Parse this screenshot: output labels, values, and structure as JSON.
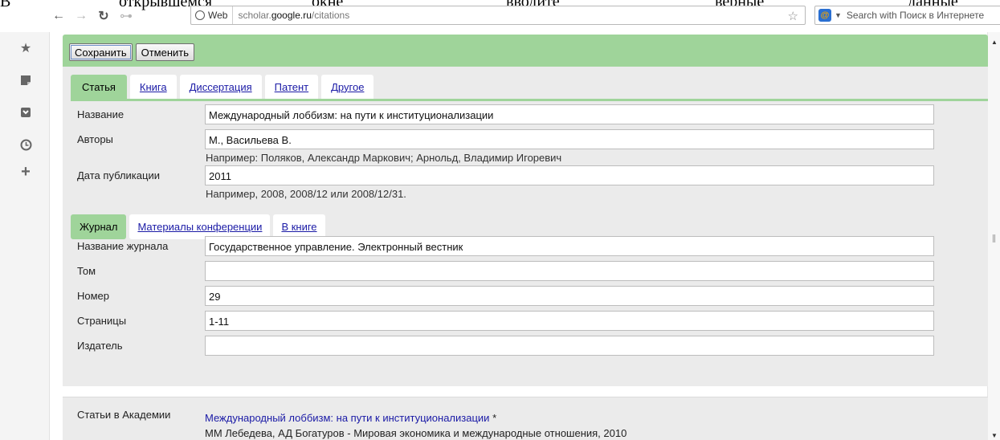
{
  "doc_words": [
    "В",
    "открывшемся",
    "окне",
    "вводите",
    "верные",
    "данные"
  ],
  "browser": {
    "nav": {
      "back_icon": "←",
      "forward_icon": "→",
      "reload_icon": "↻",
      "key_icon": "⊶"
    },
    "chip_label": "Web",
    "url_prefix": "scholar.",
    "url_domain": "google.ru",
    "url_path": "/citations",
    "search_placeholder": "Search with Поиск в Интернете"
  },
  "toolbar": {
    "save_label": "Сохранить",
    "cancel_label": "Отменить"
  },
  "tabs": [
    {
      "label": "Статья",
      "active": true
    },
    {
      "label": "Книга"
    },
    {
      "label": "Диссертация"
    },
    {
      "label": "Патент"
    },
    {
      "label": "Другое"
    }
  ],
  "fields": {
    "title_label": "Название",
    "title_value": "Международный лоббизм: на пути к институционализации",
    "authors_label": "Авторы",
    "authors_value": "М., Васильева В.",
    "authors_hint": "Например: Поляков, Александр Маркович; Арнольд, Владимир Игоревич",
    "date_label": "Дата публикации",
    "date_value": "2011",
    "date_hint": "Например, 2008, 2008/12 или 2008/12/31."
  },
  "subtabs": [
    {
      "label": "Журнал",
      "active": true
    },
    {
      "label": "Материалы конференции"
    },
    {
      "label": "В книге"
    }
  ],
  "journal": {
    "journal_label": "Название журнала",
    "journal_value": "Государственное управление. Электронный вестник",
    "volume_label": "Том",
    "volume_value": "",
    "issue_label": "Номер",
    "issue_value": "29",
    "pages_label": "Страницы",
    "pages_value": "1-11",
    "publisher_label": "Издатель",
    "publisher_value": ""
  },
  "related": {
    "label": "Статьи в Академии",
    "title": "Международный лоббизм: на пути к институционализации",
    "star": "*",
    "meta": "ММ Лебедева, АД Богатуров - Мировая экономика и международные отношения, 2010"
  }
}
